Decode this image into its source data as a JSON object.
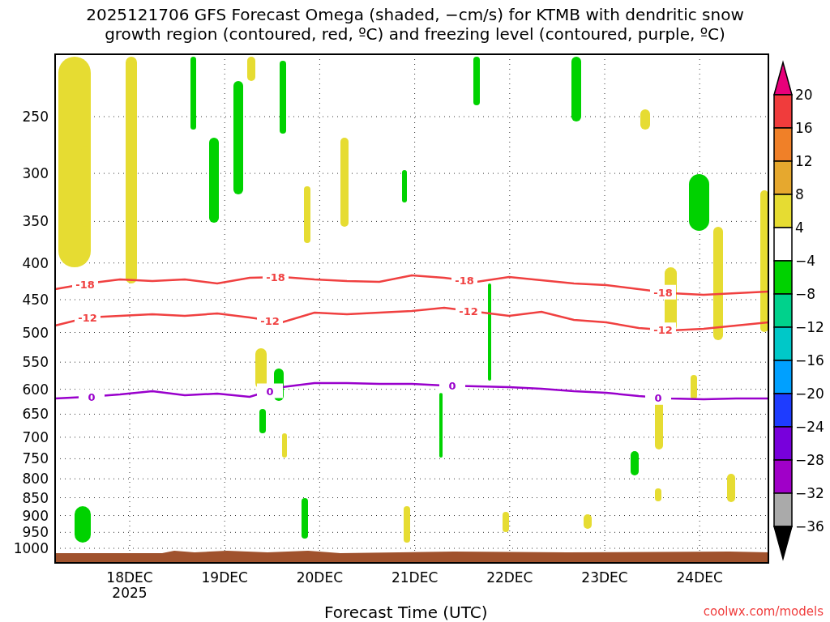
{
  "title": {
    "lines": [
      "2025121706 GFS Forecast Omega (shaded, −cm/s) for KTMB with dendritic snow",
      "growth region (contoured, red, ºC) and freezing level (contoured, purple, ºC)"
    ]
  },
  "y_axis": {
    "ticks": [
      "250",
      "300",
      "350",
      "400",
      "450",
      "500",
      "550",
      "600",
      "650",
      "700",
      "750",
      "800",
      "850",
      "900",
      "950",
      "1000"
    ]
  },
  "x_axis": {
    "ticks": [
      {
        "label": "18DEC",
        "sublabel": "2025"
      },
      {
        "label": "19DEC"
      },
      {
        "label": "20DEC"
      },
      {
        "label": "21DEC"
      },
      {
        "label": "22DEC"
      },
      {
        "label": "23DEC"
      },
      {
        "label": "24DEC"
      }
    ],
    "title": "Forecast Time (UTC)"
  },
  "contours": [
    {
      "color": "#f04040",
      "labels": [
        "-18",
        "-18",
        "-18",
        "-18"
      ]
    },
    {
      "color": "#f04040",
      "labels": [
        "-12",
        "-12",
        "-12",
        "-12"
      ]
    },
    {
      "color": "#9900cc",
      "labels": [
        "0",
        "0",
        "0",
        "0"
      ]
    }
  ],
  "colorbar": {
    "segments": [
      {
        "kind": "arrow-up",
        "color": "#e8007a"
      },
      {
        "kind": "band",
        "color": "#f03c3c"
      },
      {
        "kind": "band",
        "color": "#f08028"
      },
      {
        "kind": "band",
        "color": "#e6a82e"
      },
      {
        "kind": "band",
        "color": "#e6dc32"
      },
      {
        "kind": "band",
        "color": "#ffffff"
      },
      {
        "kind": "band",
        "color": "#00d200"
      },
      {
        "kind": "band",
        "color": "#00d28c"
      },
      {
        "kind": "band",
        "color": "#00c8c8"
      },
      {
        "kind": "band",
        "color": "#00a0ff"
      },
      {
        "kind": "band",
        "color": "#1e3cff"
      },
      {
        "kind": "band",
        "color": "#7800dc"
      },
      {
        "kind": "band",
        "color": "#a000c8"
      },
      {
        "kind": "band",
        "color": "#aaaaaa"
      },
      {
        "kind": "arrow-down",
        "color": "#000000"
      }
    ],
    "labels": [
      "20",
      "16",
      "12",
      "8",
      "4",
      "−4",
      "−8",
      "−12",
      "−16",
      "−20",
      "−24",
      "−28",
      "−32",
      "−36"
    ]
  },
  "credit": "coolwx.com/models"
}
